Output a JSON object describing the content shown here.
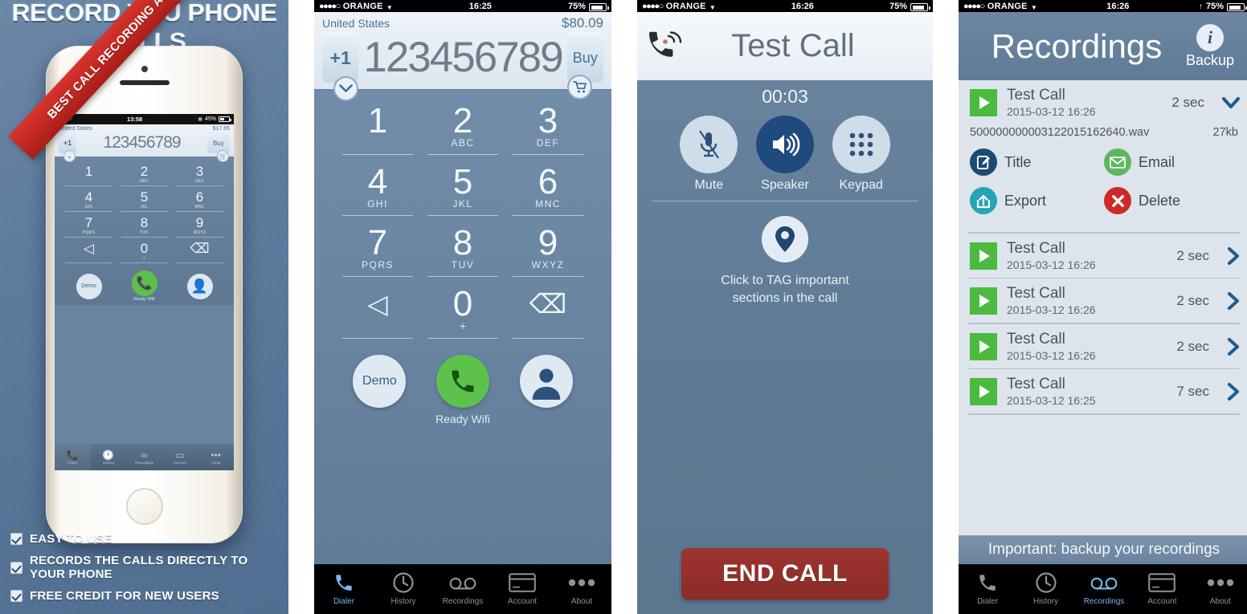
{
  "promo": {
    "headline": "RECORD YOU PHONE CALLS",
    "ribbon": "BEST CALL RECORDING APP",
    "features": [
      "EASY TO USE",
      "RECORDS THE CALLS DIRECTLY TO YOUR PHONE",
      "FREE CREDIT FOR NEW USERS"
    ],
    "mini_phone": {
      "status": {
        "signal_dots": "●●●●○",
        "time": "13:58",
        "bluetooth": "✻",
        "battery_pct": "45%"
      },
      "country": "United States",
      "balance": "$17.65",
      "prefix": "+1",
      "number": "123456789",
      "buy_label": "Buy",
      "chevron_icon": "chevron-down-icon",
      "cart_icon": "cart-icon",
      "keys": [
        {
          "digit": "1",
          "letters": ""
        },
        {
          "digit": "2",
          "letters": "ABC"
        },
        {
          "digit": "3",
          "letters": "DEF"
        },
        {
          "digit": "4",
          "letters": "GHI"
        },
        {
          "digit": "5",
          "letters": "JKL"
        },
        {
          "digit": "6",
          "letters": "MNC"
        },
        {
          "digit": "7",
          "letters": "PQRS"
        },
        {
          "digit": "8",
          "letters": "TUV"
        },
        {
          "digit": "9",
          "letters": "WXYZ"
        }
      ],
      "row4": [
        {
          "glyph": "◁",
          "sub": ""
        },
        {
          "glyph": "0",
          "sub": "+"
        },
        {
          "glyph": "⌫",
          "sub": ""
        }
      ],
      "demo_label": "Demo",
      "ready_label": "Ready Wifi",
      "tabs": [
        {
          "label": "Dialer",
          "icon": "phone-icon",
          "active": true
        },
        {
          "label": "History",
          "icon": "clock-icon",
          "active": false
        },
        {
          "label": "Recordings",
          "icon": "voicemail-icon",
          "active": false
        },
        {
          "label": "Account",
          "icon": "card-icon",
          "active": false
        },
        {
          "label": "About",
          "icon": "more-dots-icon",
          "active": false
        }
      ]
    }
  },
  "dialer": {
    "status": {
      "signal_dots": "●●●●○",
      "carrier": "ORANGE",
      "caret": "▼",
      "time": "16:25",
      "battery_pct": "75%"
    },
    "country": "United States",
    "balance": "$80.09",
    "prefix": "+1",
    "number": "123456789",
    "buy_label": "Buy",
    "chevron_icon": "chevron-down-icon",
    "cart_icon": "cart-icon",
    "keys": [
      {
        "digit": "1",
        "letters": ""
      },
      {
        "digit": "2",
        "letters": "ABC"
      },
      {
        "digit": "3",
        "letters": "DEF"
      },
      {
        "digit": "4",
        "letters": "GHI"
      },
      {
        "digit": "5",
        "letters": "JKL"
      },
      {
        "digit": "6",
        "letters": "MNC"
      },
      {
        "digit": "7",
        "letters": "PQRS"
      },
      {
        "digit": "8",
        "letters": "TUV"
      },
      {
        "digit": "9",
        "letters": "WXYZ"
      }
    ],
    "row4": [
      {
        "glyph": "◁",
        "sub": ""
      },
      {
        "glyph": "0",
        "sub": "+"
      },
      {
        "glyph": "⌫",
        "sub": ""
      }
    ],
    "demo_label": "Demo",
    "ready_label": "Ready Wifi",
    "tabs": [
      {
        "label": "Dialer",
        "icon": "phone-icon",
        "active": true
      },
      {
        "label": "History",
        "icon": "clock-icon",
        "active": false
      },
      {
        "label": "Recordings",
        "icon": "voicemail-icon",
        "active": false
      },
      {
        "label": "Account",
        "icon": "card-icon",
        "active": false
      },
      {
        "label": "About",
        "icon": "more-dots-icon",
        "active": false
      }
    ]
  },
  "call": {
    "status": {
      "signal_dots": "●●●●○",
      "carrier": "ORANGE",
      "caret": "▼",
      "time": "16:26",
      "battery_pct": "75%"
    },
    "header_icon": "phone-ringing-icon",
    "title": "Test Call",
    "timer": "00:03",
    "controls": [
      {
        "label": "Mute",
        "icon": "mic-muted-icon",
        "state": "off"
      },
      {
        "label": "Speaker",
        "icon": "speaker-icon",
        "state": "on"
      },
      {
        "label": "Keypad",
        "icon": "keypad-dots-icon",
        "state": "off"
      }
    ],
    "tag_icon": "map-pin-icon",
    "tag_text_line1": "Click to TAG important",
    "tag_text_line2": "sections in the call",
    "end_call_label": "END CALL"
  },
  "recordings": {
    "status": {
      "signal_dots": "●●●●○",
      "carrier": "ORANGE",
      "caret": "▼",
      "time": "16:26",
      "battery_pct": "75%",
      "upload_arrow": "↑"
    },
    "title": "Recordings",
    "info_icon": "info-icon",
    "backup_label": "Backup",
    "expanded": {
      "name": "Test Call",
      "date": "2015-03-12 16:26",
      "duration": "2 sec",
      "chevron": "expanded",
      "filename": "500000000003122015162640.wav",
      "filesize": "27kb",
      "actions": [
        {
          "label": "Title",
          "icon": "edit-icon",
          "color": "#1b4a72"
        },
        {
          "label": "Email",
          "icon": "envelope-icon",
          "color": "#5cb85c"
        },
        {
          "label": "Export",
          "icon": "share-icon",
          "color": "#27a3b5"
        },
        {
          "label": "Delete",
          "icon": "close-x-icon",
          "color": "#cf2a2a"
        }
      ]
    },
    "items": [
      {
        "name": "Test Call",
        "date": "2015-03-12 16:26",
        "duration": "2 sec"
      },
      {
        "name": "Test Call",
        "date": "2015-03-12 16:26",
        "duration": "2 sec"
      },
      {
        "name": "Test Call",
        "date": "2015-03-12 16:26",
        "duration": "2 sec"
      },
      {
        "name": "Test Call",
        "date": "2015-03-12 16:25",
        "duration": "7 sec"
      }
    ],
    "banner": "Important: backup your recordings",
    "tabs": [
      {
        "label": "Dialer",
        "icon": "phone-icon",
        "active": false
      },
      {
        "label": "History",
        "icon": "clock-icon",
        "active": false
      },
      {
        "label": "Recordings",
        "icon": "voicemail-icon",
        "active": true
      },
      {
        "label": "Account",
        "icon": "card-icon",
        "active": false
      },
      {
        "label": "About",
        "icon": "more-dots-icon",
        "active": false
      }
    ]
  }
}
